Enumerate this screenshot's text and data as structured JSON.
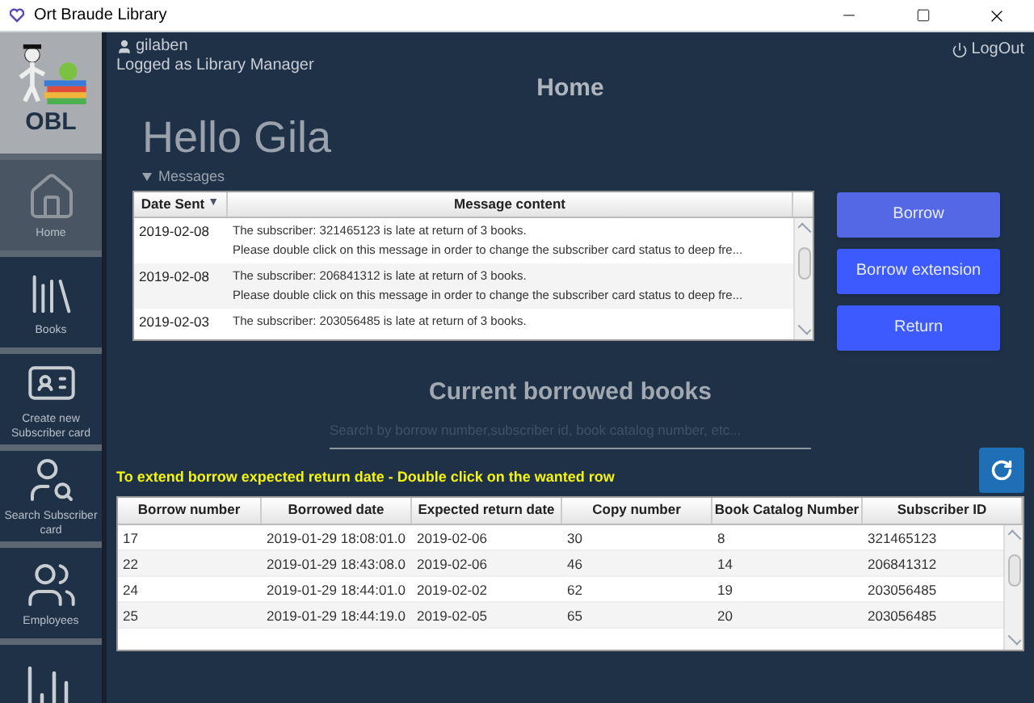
{
  "window": {
    "title": "Ort Braude Library"
  },
  "sidebar": {
    "brand": "OBL",
    "items": [
      {
        "kind": "home",
        "label": "Home",
        "selected": true
      },
      {
        "kind": "books",
        "label": "Books",
        "selected": false
      },
      {
        "kind": "new-card",
        "label": "Create new Subscriber card",
        "selected": false
      },
      {
        "kind": "search-card",
        "label": "Search Subscriber card",
        "selected": false
      },
      {
        "kind": "employees",
        "label": "Employees",
        "selected": false
      },
      {
        "kind": "reports",
        "selected": false
      }
    ]
  },
  "user": {
    "username": "gilaben",
    "role": "Logged as Library Manager"
  },
  "logout": "LogOut",
  "page_title": "Home",
  "greeting": "Hello Gila",
  "messages": {
    "label": "Messages",
    "expanded": true,
    "columns": [
      {
        "label": "Date Sent",
        "sort_mark": "▼"
      },
      {
        "label": "Message content"
      }
    ],
    "rows": [
      {
        "date": "2019-02-08",
        "lines": [
          "The subscriber: 321465123 is late at return of 3 books.",
          "Please double click on this message in order to change the subscriber card status to deep fre..."
        ]
      },
      {
        "date": "2019-02-08",
        "lines": [
          "The subscriber: 206841312 is late at return of 3 books.",
          "Please double click on this message in order to change the subscriber card status to deep fre..."
        ]
      },
      {
        "date": "2019-02-03",
        "lines": [
          "The subscriber: 203056485 is late at return of 3 books."
        ]
      }
    ]
  },
  "actions": [
    "Borrow",
    "Borrow extension",
    "Return"
  ],
  "borrowed": {
    "title": "Current borrowed books",
    "search": {
      "placeholder": "Search by borrow number,subscriber id, book catalog number, etc..."
    },
    "hint": "To extend borrow expected return date  - Double click on the wanted row",
    "columns": [
      "Borrow number",
      "Borrowed date",
      "Expected return date",
      "Copy number",
      "Book Catalog Number",
      "Subscriber ID"
    ],
    "rows": [
      [
        "17",
        "2019-01-29 18:08:01.0",
        "2019-02-06",
        "30",
        "8",
        "321465123"
      ],
      [
        "22",
        "2019-01-29 18:43:08.0",
        "2019-02-06",
        "46",
        "14",
        "206841312"
      ],
      [
        "24",
        "2019-01-29 18:44:01.0",
        "2019-02-02",
        "62",
        "19",
        "203056485"
      ],
      [
        "25",
        "2019-01-29 18:44:19.0",
        "2019-02-05",
        "65",
        "20",
        "203056485"
      ]
    ]
  }
}
